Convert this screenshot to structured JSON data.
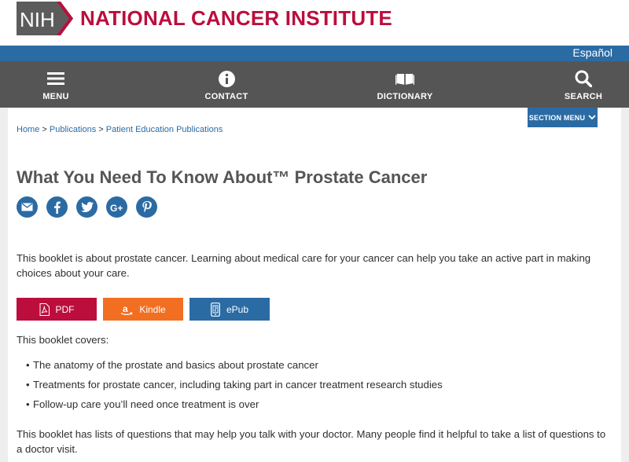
{
  "header": {
    "logo_text": "NIH",
    "site_name": "NATIONAL CANCER INSTITUTE",
    "language_link": "Español",
    "brand_color": "#bb0e3d",
    "accent_color": "#2b6ba4"
  },
  "nav": {
    "items": [
      {
        "label": "MENU",
        "icon": "hamburger-icon"
      },
      {
        "label": "CONTACT",
        "icon": "info-icon"
      },
      {
        "label": "DICTIONARY",
        "icon": "book-icon"
      },
      {
        "label": "SEARCH",
        "icon": "search-icon"
      }
    ]
  },
  "section_menu": {
    "label": "SECTION MENU",
    "icon": "chevron-down-icon"
  },
  "breadcrumb": {
    "items": [
      "Home",
      "Publications",
      "Patient Education Publications"
    ],
    "separator": ">"
  },
  "page": {
    "title": "What You Need To Know About™ Prostate Cancer",
    "share_icons": [
      "email-icon",
      "facebook-icon",
      "twitter-icon",
      "google-plus-icon",
      "pinterest-icon"
    ],
    "intro": "This booklet is about prostate cancer. Learning about medical care for your cancer can help you take an active part in making choices about your care.",
    "downloads": [
      {
        "label": "PDF",
        "icon": "pdf-icon",
        "color": "#bb0e3d"
      },
      {
        "label": "Kindle",
        "icon": "amazon-icon",
        "color": "#f26f21"
      },
      {
        "label": "ePub",
        "icon": "ebook-icon",
        "color": "#2b6ba4"
      }
    ],
    "covers_heading": "This booklet covers:",
    "covers_items": [
      "The anatomy of the prostate and basics about prostate cancer",
      "Treatments for prostate cancer, including taking part in cancer treatment research studies",
      "Follow-up care you’ll need once treatment is over"
    ],
    "closing": "This booklet has lists of questions that may help you talk with your doctor. Many people find it helpful to take a list of questions to a doctor visit."
  }
}
